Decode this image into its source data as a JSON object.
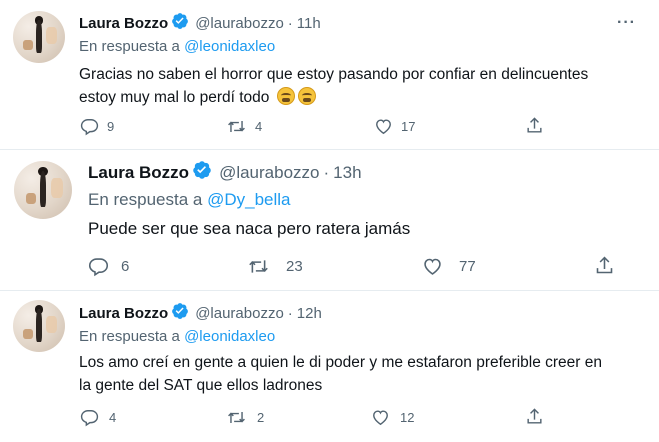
{
  "tweets": [
    {
      "name": "Laura Bozzo",
      "handle": "@laurabozzo",
      "time": "11h",
      "more": "···",
      "reply_prefix": "En respuesta a",
      "reply_to": "@leonidaxleo",
      "text_line1": "Gracias no saben el horror que estoy pasando por confiar en delincuentes",
      "text_line2": "estoy muy mal lo perdí todo",
      "emojis": [
        "weary-face",
        "weary-face"
      ],
      "replies": "9",
      "retweets": "4",
      "likes": "17"
    },
    {
      "name": "Laura Bozzo",
      "handle": "@laurabozzo",
      "time": "13h",
      "reply_prefix": "En respuesta a",
      "reply_to": "@Dy_bella",
      "text_line1": "Puede ser que sea naca pero ratera jamás",
      "replies": "6",
      "retweets": "23",
      "likes": "77"
    },
    {
      "name": "Laura Bozzo",
      "handle": "@laurabozzo",
      "time": "12h",
      "reply_prefix": "En respuesta a",
      "reply_to": "@leonidaxleo",
      "text_line1": "Los amo creí en gente a quien le di poder y me estafaron preferible creer en",
      "text_line2": "la gente del SAT que ellos ladrones",
      "replies": "4",
      "retweets": "2",
      "likes": "12"
    }
  ],
  "separator_dot": "·",
  "colors": {
    "accent": "#1d9bf0",
    "muted": "#536471",
    "text": "#0f1419",
    "divider": "#e6ecf0"
  },
  "icons": [
    "verified-badge-icon",
    "reply-icon",
    "retweet-icon",
    "like-icon",
    "share-icon",
    "more-icon"
  ]
}
